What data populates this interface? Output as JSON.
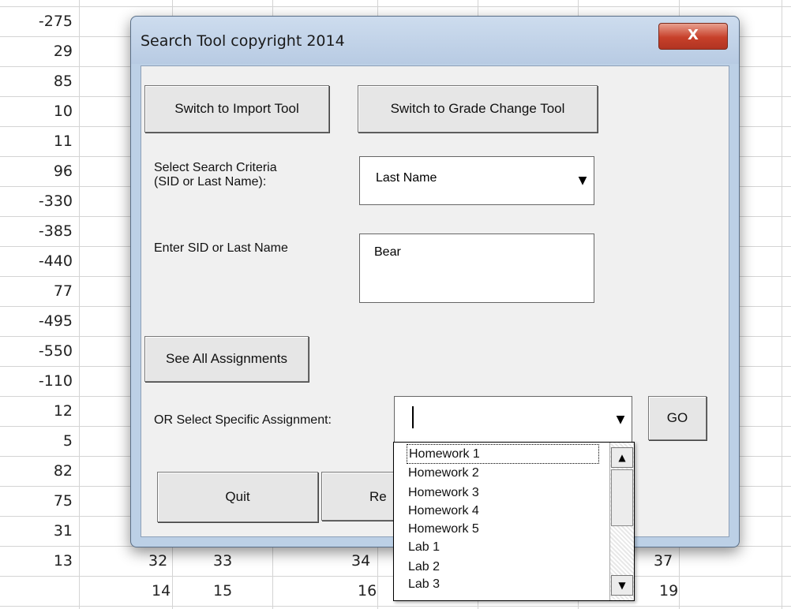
{
  "sheet": {
    "left_values": [
      "-275",
      "29",
      "85",
      "10",
      "11",
      "96",
      "-330",
      "-385",
      "-440",
      "77",
      "-495",
      "-550",
      "-110",
      "12",
      "5",
      "82",
      "75",
      "31",
      "13"
    ],
    "row_31": [
      "32",
      "33",
      "34",
      "37"
    ],
    "row_13": [
      "14",
      "15",
      "16",
      "19"
    ]
  },
  "dialog": {
    "title": "Search Tool copyright 2014",
    "close_label": "X",
    "import_button": "Switch to Import Tool",
    "grade_change_button": "Switch to Grade Change Tool",
    "criteria_label_line1": "Select Search Criteria",
    "criteria_label_line2": "(SID or Last Name):",
    "criteria_value": "Last Name",
    "enter_label": "Enter SID or Last Name",
    "search_value": "Bear",
    "see_all_button": "See All Assignments",
    "select_assignment_label": "OR Select Specific Assignment:",
    "assignment_value": "",
    "go_button": "GO",
    "quit_button": "Quit",
    "reset_button_partial": "Re"
  },
  "dropdown": {
    "options": [
      "Homework 1",
      "Homework 2",
      "Homework 3",
      "Homework 4",
      "Homework 5",
      "Lab 1",
      "Lab 2",
      "Lab 3"
    ],
    "selected_index": 0
  },
  "icons": {
    "dropdown_arrow": "triangle-down",
    "scroll_up": "triangle-up",
    "scroll_down": "triangle-down"
  }
}
